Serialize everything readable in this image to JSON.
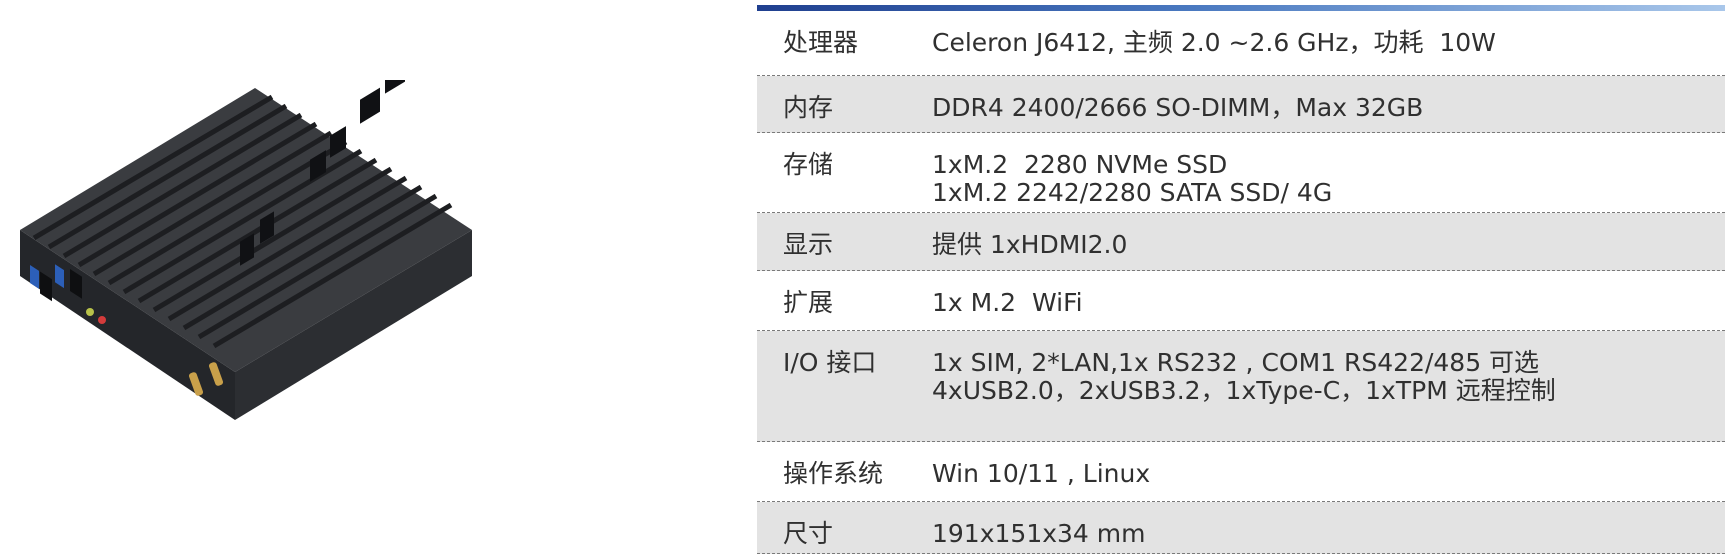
{
  "specs": [
    {
      "label": "处理器",
      "lines": [
        "Celeron J6412, 主频 2.0 ~2.6 GHz，功耗  10W"
      ]
    },
    {
      "label": "内存",
      "lines": [
        "DDR4 2400/2666 SO-DIMM，Max 32GB"
      ]
    },
    {
      "label": "存储",
      "lines": [
        "1xM.2  2280 NVMe SSD",
        "1xM.2 2242/2280 SATA SSD/ 4G"
      ]
    },
    {
      "label": "显示",
      "lines": [
        "提供 1xHDMI2.0"
      ]
    },
    {
      "label": "扩展",
      "lines": [
        "1x M.2  WiFi"
      ]
    },
    {
      "label": "I/O 接口",
      "lines": [
        "1x SIM, 2*LAN,1x RS232 , COM1 RS422/485 可选",
        "4xUSB2.0，2xUSB3.2，1xType-C，1xTPM 远程控制"
      ]
    },
    {
      "label": "操作系统",
      "lines": [
        "Win 10/11 , Linux"
      ]
    },
    {
      "label": "尺寸",
      "lines": [
        "191x151x34 mm"
      ]
    }
  ],
  "colors": {
    "accent": "#2a55a8",
    "row_shade": "#e3e3e3",
    "text": "#303030"
  }
}
